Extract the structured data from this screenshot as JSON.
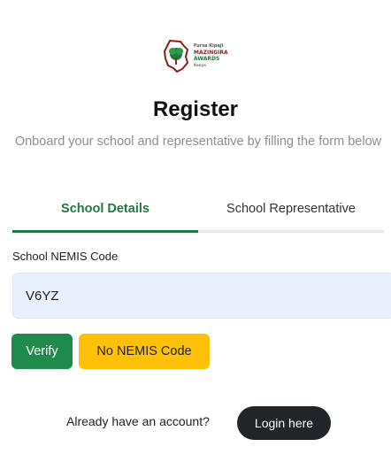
{
  "logo": {
    "line1": "Fursa Kipaji",
    "line2": "MAZINGIRA",
    "line3": "AWARDS",
    "line4": "Kenya",
    "colors": {
      "green": "#1e7a3c",
      "red": "#8b1d1d"
    }
  },
  "header": {
    "title": "Register",
    "subtitle": "Onboard your school and representative by filling the form below"
  },
  "tabs": [
    {
      "label": "School Details",
      "active": true
    },
    {
      "label": "School Representative",
      "active": false
    }
  ],
  "form": {
    "nemis_label": "School NEMIS Code",
    "nemis_value": "V6YZ"
  },
  "buttons": {
    "verify": "Verify",
    "no_nemis": "No NEMIS Code",
    "login": "Login here"
  },
  "footer": {
    "account_text": "Already have an account?"
  },
  "colors": {
    "accent_green": "#1e7a3c",
    "verify_green": "#1f8a4c",
    "warning_yellow": "#ffc107",
    "dark_button": "#212529",
    "input_bg": "#e8effd"
  }
}
